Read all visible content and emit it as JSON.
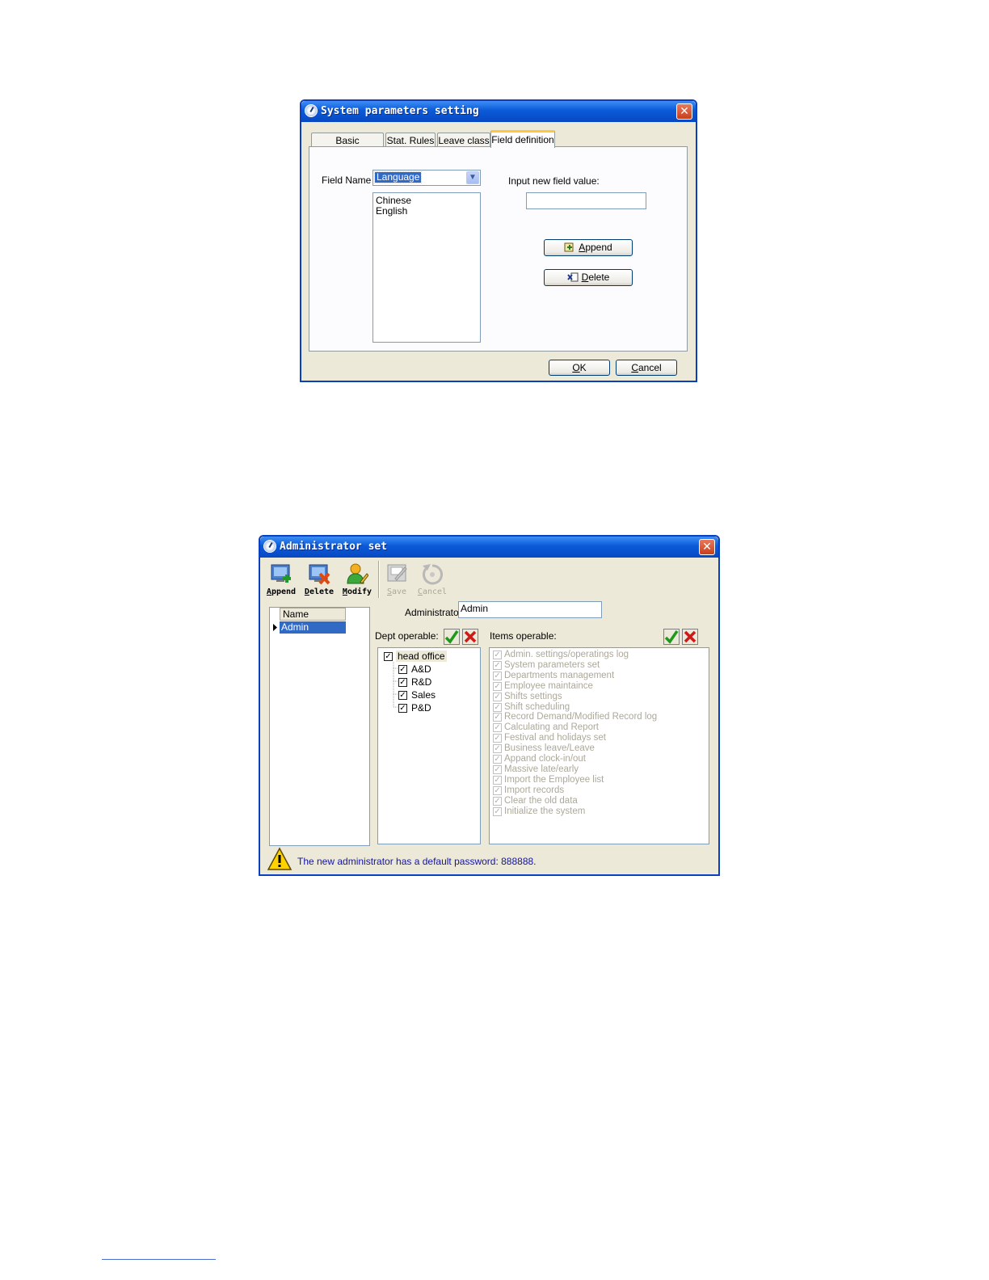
{
  "dialog1": {
    "title": "System parameters setting",
    "close_label": "✕",
    "tabs": [
      {
        "label": "Basic parameters"
      },
      {
        "label": "Stat. Rules"
      },
      {
        "label": "Leave class"
      },
      {
        "label": "Field definition"
      }
    ],
    "field_name_label": "Field Name :",
    "field_name_value": "Language",
    "field_values": [
      "Chinese",
      "English"
    ],
    "input_label": "Input new field value:",
    "input_value": "",
    "append_button": {
      "accel": "A",
      "rest": "ppend"
    },
    "delete_button": {
      "accel": "D",
      "rest": "elete"
    },
    "ok_button": {
      "accel": "O",
      "rest": "K"
    },
    "cancel_button": {
      "accel": "C",
      "rest": "ancel"
    }
  },
  "dialog2": {
    "title": "Administrator set",
    "close_label": "✕",
    "toolbar": [
      {
        "accel": "A",
        "rest": "ppend",
        "icon": "append-user-icon",
        "enabled": true
      },
      {
        "accel": "D",
        "rest": "elete",
        "icon": "delete-user-icon",
        "enabled": true
      },
      {
        "accel": "M",
        "rest": "odify",
        "icon": "modify-user-icon",
        "enabled": true
      },
      {
        "accel": "S",
        "rest": "ave",
        "icon": "save-icon",
        "enabled": false
      },
      {
        "accel": "C",
        "rest": "ancel",
        "icon": "cancel-icon",
        "enabled": false
      }
    ],
    "grid": {
      "column_header": "Name",
      "rows": [
        "Admin"
      ]
    },
    "administrator_label": "Administrator:",
    "administrator_value": "Admin",
    "dept_label": "Dept operable:",
    "items_label": "Items operable:",
    "dept_tree": {
      "root": "head office",
      "children": [
        "A&D",
        "R&D",
        "Sales",
        "P&D"
      ]
    },
    "items": [
      "Admin. settings/operatings log",
      "System parameters set",
      "Departments management",
      "Employee maintaince",
      "Shifts settings",
      "Shift scheduling",
      "Record Demand/Modified Record log",
      "Calculating and Report",
      "Festival and holidays set",
      "Business leave/Leave",
      "Appand clock-in/out",
      "Massive late/early",
      "Import the Employee list",
      "Import records",
      "Clear the old data",
      "Initialize the system"
    ],
    "warning_message": "The new administrator has a default password: 888888."
  },
  "colors": {
    "titlebar": "#0a5ad8",
    "dialog_bg": "#ece9d8",
    "selection": "#316ac5",
    "message_text": "#1414a0"
  }
}
